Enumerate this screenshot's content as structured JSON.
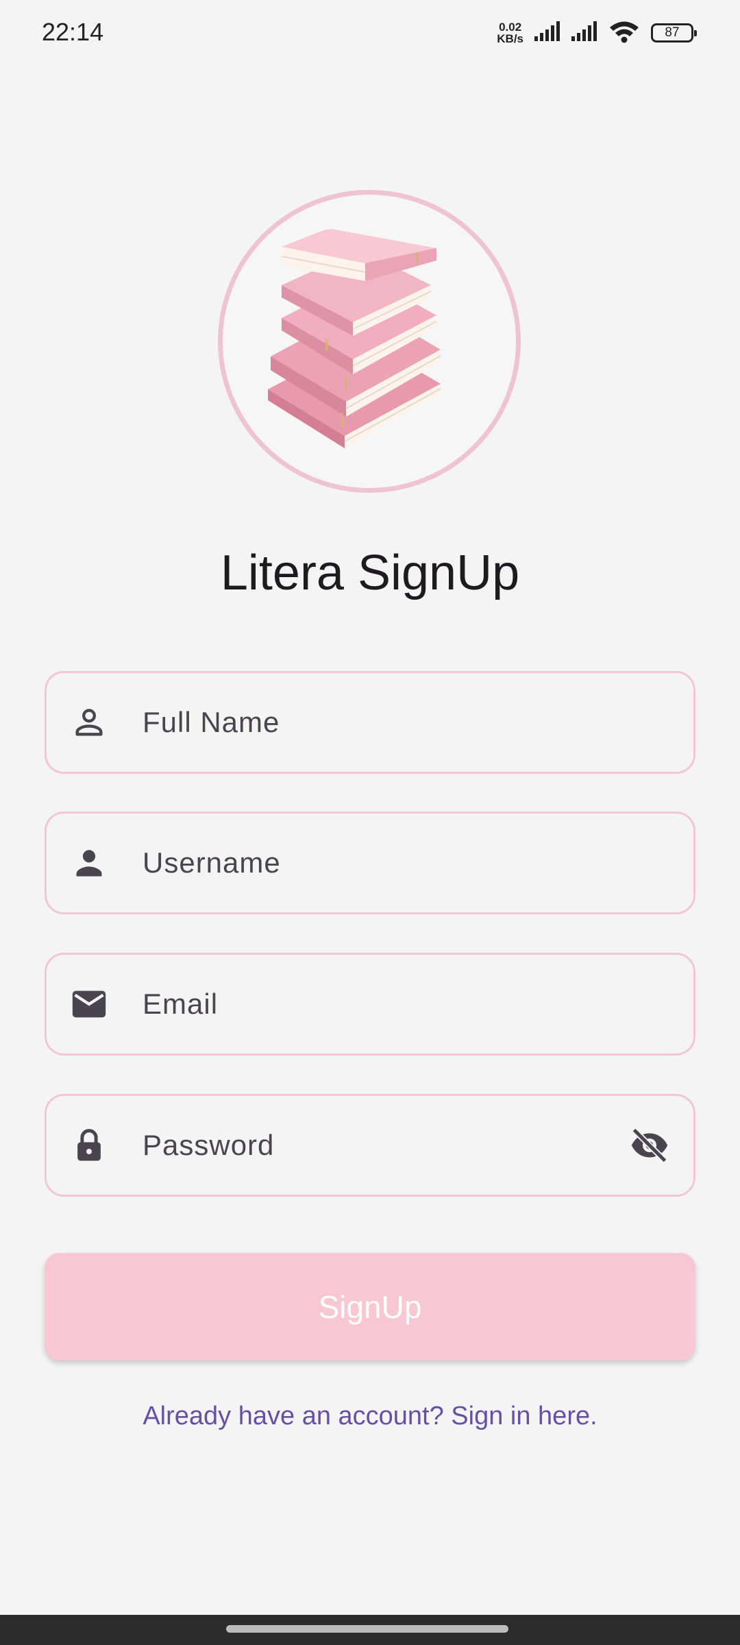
{
  "status_bar": {
    "time": "22:14",
    "net_speed_value": "0.02",
    "net_speed_unit": "KB/s",
    "battery": "87"
  },
  "logo": {
    "icon": "book-stack-icon",
    "accent_color": "#efc4d2"
  },
  "title": "Litera SignUp",
  "form": {
    "full_name": {
      "placeholder": "Full Name",
      "icon": "person-outline-icon"
    },
    "username": {
      "placeholder": "Username",
      "icon": "person-icon"
    },
    "email": {
      "placeholder": "Email",
      "icon": "mail-icon"
    },
    "password": {
      "placeholder": "Password",
      "icon": "lock-icon",
      "toggle_icon": "eye-off-icon"
    }
  },
  "signup_button": {
    "label": "SignUp",
    "color": "#f7c7d3"
  },
  "signin_link": {
    "label": "Already have an account? Sign in here.",
    "color": "#6750a4"
  }
}
